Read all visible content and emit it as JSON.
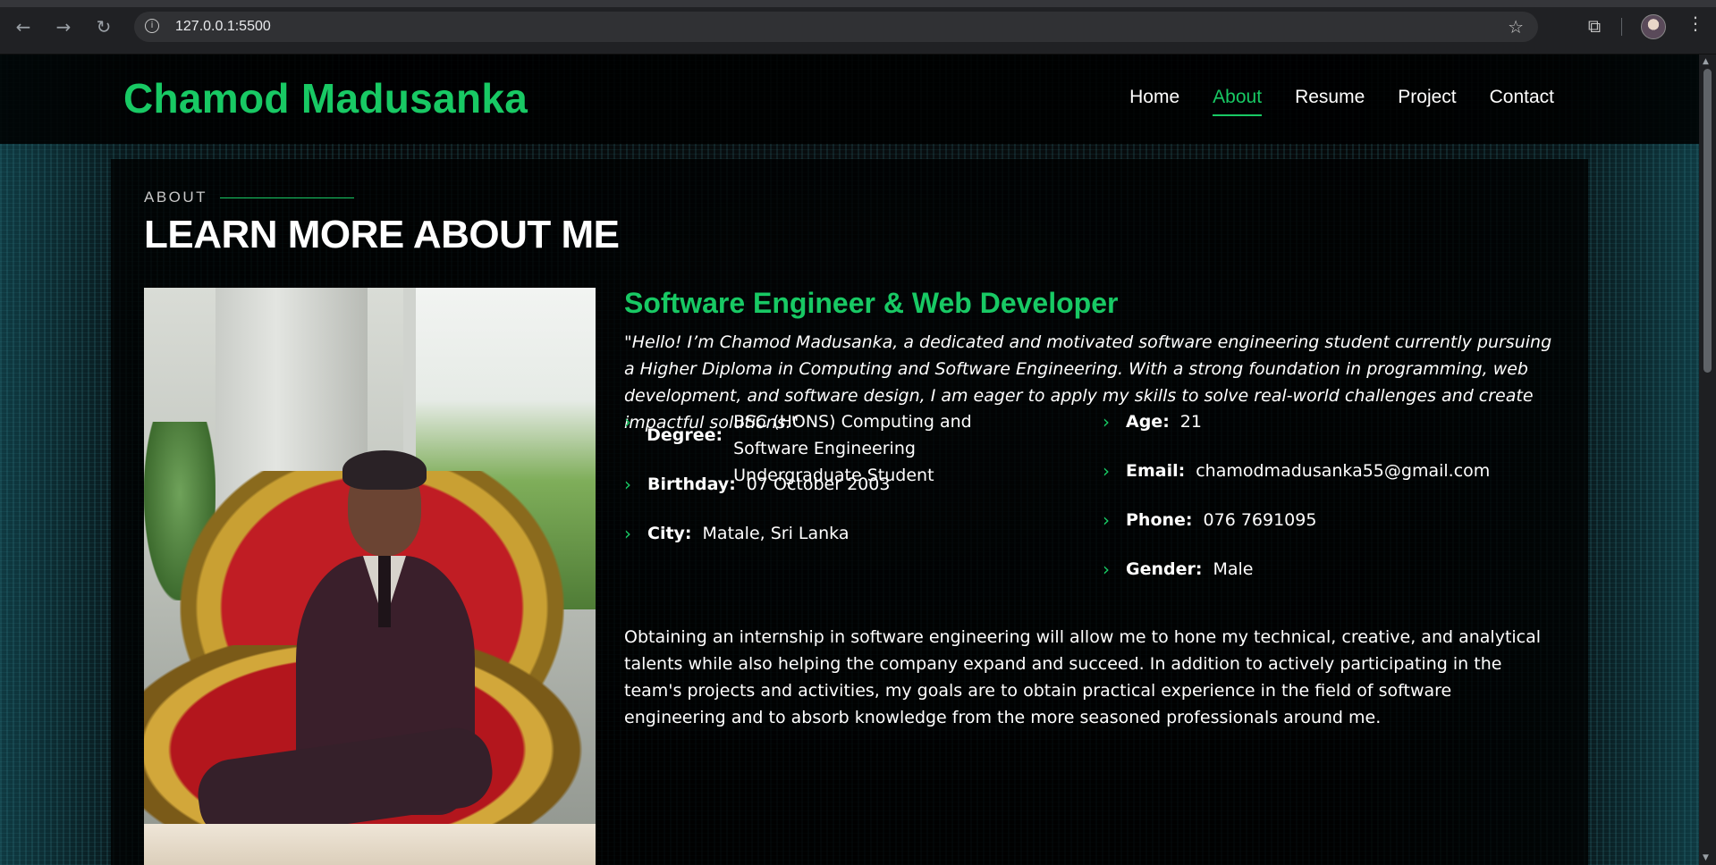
{
  "browser": {
    "url": "127.0.0.1:5500",
    "back_icon": "arrow-left-icon",
    "forward_icon": "arrow-right-icon",
    "reload_icon": "reload-icon"
  },
  "header": {
    "logo": "Chamod Madusanka",
    "nav": [
      "Home",
      "About",
      "Resume",
      "Project",
      "Contact"
    ],
    "active": "About"
  },
  "about": {
    "label": "ABOUT",
    "title": "LEARN MORE ABOUT ME",
    "role": "Software Engineer & Web Developer",
    "quote": "\"Hello! I’m Chamod Madusanka, a dedicated and motivated software engineering student currently pursuing a Higher Diploma in Computing and Software Engineering. With a strong foundation in programming, web development, and software design, I am eager to apply my skills to solve real-world challenges and create impactful solutions.\"",
    "details_left": [
      {
        "label": "Degree:",
        "value": "BSC (HONS) Computing and Software Engineering Undergraduate Student"
      },
      {
        "label": "Birthday:",
        "value": "07 October 2003"
      },
      {
        "label": "City:",
        "value": "Matale, Sri Lanka"
      }
    ],
    "details_right": [
      {
        "label": "Age:",
        "value": "21"
      },
      {
        "label": "Email:",
        "value": "chamodmadusanka55@gmail.com"
      },
      {
        "label": "Phone:",
        "value": "076 7691095"
      },
      {
        "label": "Gender:",
        "value": "Male"
      }
    ],
    "paragraph": "Obtaining an internship in software engineering will allow me to hone my technical, creative, and analytical talents while also helping the company expand and succeed. In addition to actively participating in the team's projects and activities, my goals are to obtain practical experience in the field of software engineering and to absorb knowledge from the more seasoned professionals around me."
  },
  "colors": {
    "accent": "#18c964",
    "background": "#050708"
  }
}
